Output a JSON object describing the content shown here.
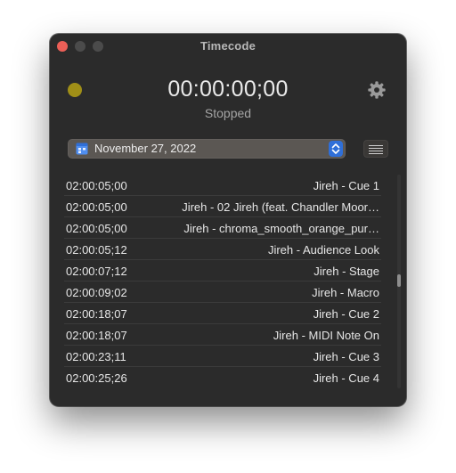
{
  "window": {
    "title": "Timecode"
  },
  "recorder": {
    "timecode": "00:00:00;00",
    "status": "Stopped",
    "indicator_color": "#a08f17"
  },
  "date_selector": {
    "value": "November 27, 2022",
    "icon": "calendar-icon"
  },
  "toolbar": {
    "settings_icon": "gear-icon",
    "list_icon": "list-icon"
  },
  "cues": [
    {
      "timecode": "02:00:05;00",
      "name": "Jireh - Cue 1"
    },
    {
      "timecode": "02:00:05;00",
      "name": "Jireh - 02 Jireh (feat. Chandler Moor…"
    },
    {
      "timecode": "02:00:05;00",
      "name": "Jireh - chroma_smooth_orange_pur…"
    },
    {
      "timecode": "02:00:05;12",
      "name": "Jireh - Audience Look"
    },
    {
      "timecode": "02:00:07;12",
      "name": "Jireh - Stage"
    },
    {
      "timecode": "02:00:09;02",
      "name": "Jireh - Macro"
    },
    {
      "timecode": "02:00:18;07",
      "name": "Jireh - Cue 2"
    },
    {
      "timecode": "02:00:18;07",
      "name": "Jireh - MIDI Note On"
    },
    {
      "timecode": "02:00:23;11",
      "name": "Jireh - Cue 3"
    },
    {
      "timecode": "02:00:25;26",
      "name": "Jireh - Cue 4"
    }
  ],
  "colors": {
    "window_bg": "#2b2b2b",
    "close_button": "#ec5f57",
    "select_bg": "#5b5753",
    "stepper_accent": "#2f6fd8"
  }
}
